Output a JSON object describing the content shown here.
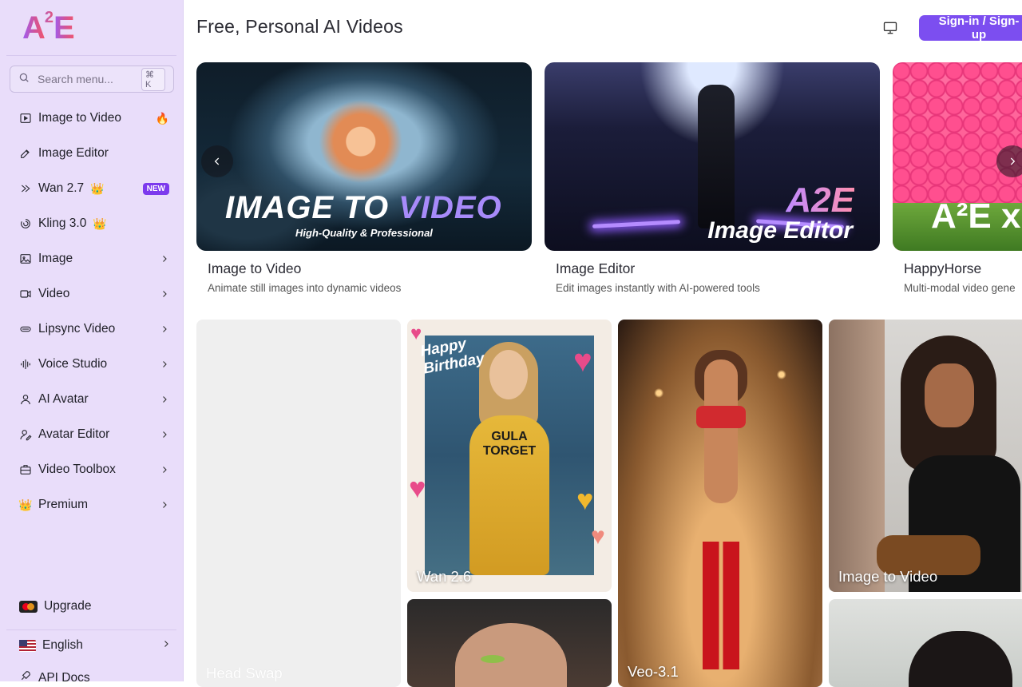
{
  "brand": {
    "logo_main": "A",
    "logo_sup": "2",
    "logo_end": "E"
  },
  "sidebar": {
    "search_placeholder": "Search menu...",
    "search_shortcut": "⌘ K",
    "items": [
      {
        "label": "Image to Video",
        "icon": "play-square-icon",
        "badge": "🔥"
      },
      {
        "label": "Image Editor",
        "icon": "edit-icon"
      },
      {
        "label": "Wan 2.7",
        "icon": "wan-icon",
        "emoji": "👑",
        "badge": "NEW"
      },
      {
        "label": "Kling 3.0",
        "icon": "kling-icon",
        "emoji": "👑"
      },
      {
        "label": "Image",
        "icon": "image-icon"
      },
      {
        "label": "Video",
        "icon": "video-icon"
      },
      {
        "label": "Lipsync Video",
        "icon": "lips-icon"
      },
      {
        "label": "Voice Studio",
        "icon": "waveform-icon"
      },
      {
        "label": "AI Avatar",
        "icon": "user-icon"
      },
      {
        "label": "Avatar Editor",
        "icon": "user-edit-icon"
      },
      {
        "label": "Video Toolbox",
        "icon": "toolbox-icon"
      },
      {
        "label": "Premium",
        "icon": "crown-icon",
        "emoji": "👑"
      }
    ],
    "upgrade_label": "Upgrade",
    "language_label": "English",
    "api_docs_label": "API Docs"
  },
  "header": {
    "title": "Free, Personal AI Videos",
    "signin_label": "Sign-in / Sign-up"
  },
  "carousel": {
    "slides": [
      {
        "title": "Image to Video",
        "desc": "Animate still images into dynamic videos",
        "banner_main": "IMAGE TO ",
        "banner_accent": "VIDEO",
        "banner_sub": "High-Quality & Professional"
      },
      {
        "title": "Image Editor",
        "desc": "Edit images instantly with AI-powered tools",
        "banner_brand": "A2E",
        "banner_sub": "Image Editor"
      },
      {
        "title": "HappyHorse",
        "desc": "Multi-modal video gene",
        "banner_brand": "A²E x"
      }
    ]
  },
  "gallery": {
    "head_swap": "Head Swap",
    "wan": "Wan 2.6",
    "wan_card_text": "Happy Birthday",
    "wan_shirt": "GULA TORGET",
    "veo": "Veo-3.1",
    "image_to_video": "Image to Video"
  },
  "colors": {
    "accent": "#7c4ef0",
    "sidebar_bg": "#e9ddfa",
    "new_badge": "#7c3aed"
  }
}
